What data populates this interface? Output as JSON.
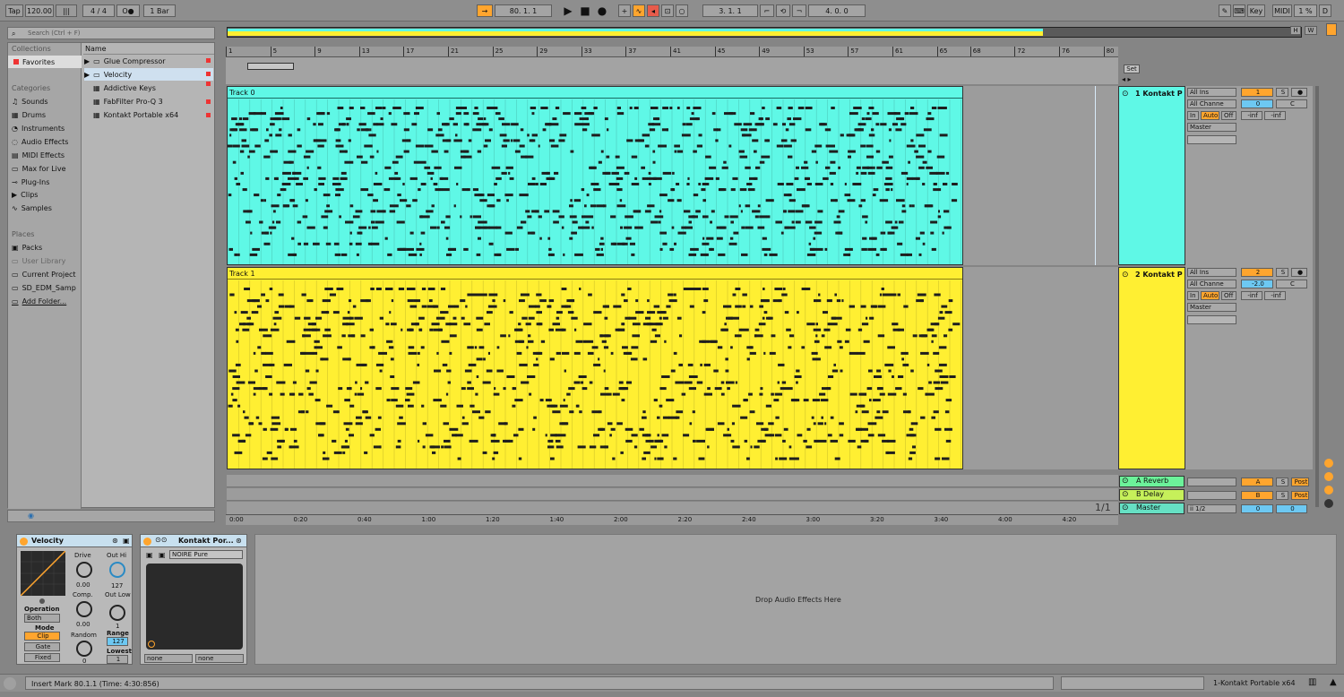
{
  "toolbar": {
    "tap": "Tap",
    "tempo": "120.00",
    "signature": "4 / 4",
    "metro": "O●",
    "quantize": "1 Bar",
    "arr_pos": "80.  1.  1",
    "loop_start": "3.  1.  1",
    "loop_len": "4.  0.  0",
    "key": "Key",
    "midi": "MIDI",
    "cpu": "1 %",
    "d": "D"
  },
  "browser": {
    "search_placeholder": "Search (Ctrl + F)",
    "collections_label": "Collections",
    "favorites": "Favorites",
    "categories_label": "Categories",
    "categories": [
      "Sounds",
      "Drums",
      "Instruments",
      "Audio Effects",
      "MIDI Effects",
      "Max for Live",
      "Plug-Ins",
      "Clips",
      "Samples"
    ],
    "places_label": "Places",
    "places": [
      "Packs",
      "User Library",
      "Current Project",
      "SD_EDM_Samp",
      "Add Folder..."
    ],
    "name_header": "Name",
    "items": [
      "Glue Compressor",
      "Velocity",
      "Addictive Keys",
      "FabFilter Pro-Q 3",
      "Kontakt Portable x64"
    ]
  },
  "ruler": {
    "bars": [
      "1",
      "5",
      "9",
      "13",
      "17",
      "21",
      "25",
      "29",
      "33",
      "37",
      "41",
      "45",
      "49",
      "53",
      "57",
      "61",
      "65",
      "68",
      "72",
      "76",
      "80"
    ],
    "times": [
      "0:00",
      "0:20",
      "0:40",
      "1:00",
      "1:20",
      "1:40",
      "2:00",
      "2:20",
      "2:40",
      "3:00",
      "3:20",
      "3:40",
      "4:00",
      "4:20"
    ],
    "zoom": "1/1",
    "set": "Set"
  },
  "tracks": [
    {
      "clip": "Track 0",
      "name": "1 Kontakt P",
      "input": "All Ins",
      "channel": "All Channe",
      "monitor": [
        "In",
        "Auto",
        "Off"
      ],
      "output": "Master",
      "number": "1",
      "solo": "S",
      "vol": "0",
      "pan": "C",
      "inf1": "-inf",
      "inf2": "-inf",
      "color": "#5ff8e6"
    },
    {
      "clip": "Track 1",
      "name": "2 Kontakt P",
      "input": "All Ins",
      "channel": "All Channe",
      "monitor": [
        "In",
        "Auto",
        "Off"
      ],
      "output": "Master",
      "number": "2",
      "solo": "S",
      "vol": "-2.0",
      "pan": "C",
      "inf1": "-inf",
      "inf2": "-inf",
      "color": "#ffef32"
    }
  ],
  "returns": [
    {
      "name": "A Reverb",
      "btn": "A",
      "solo": "S",
      "post": "Post"
    },
    {
      "name": "B Delay",
      "btn": "B",
      "solo": "S",
      "post": "Post"
    }
  ],
  "master": {
    "name": "Master",
    "cue": "ii 1/2",
    "vol": "0",
    "pan": "0"
  },
  "devices": {
    "velocity": {
      "title": "Velocity",
      "drive": "Drive",
      "drive_val": "0.00",
      "comp": "Comp.",
      "comp_val": "0.00",
      "random": "Random",
      "random_val": "0",
      "out_hi": "Out Hi",
      "out_hi_val": "127",
      "out_low": "Out Low",
      "out_low_val": "1",
      "range": "Range",
      "range_val": "127",
      "lowest": "Lowest",
      "lowest_val": "1",
      "operation": "Operation",
      "operation_val": "Both",
      "mode": "Mode",
      "modes": [
        "Clip",
        "Gate",
        "Fixed"
      ]
    },
    "kontakt": {
      "title": "Kontakt Por...",
      "preset": "NOIRE Pure",
      "sel1": "none",
      "sel2": "none"
    },
    "drop_text": "Drop Audio Effects Here"
  },
  "status": {
    "text": "Insert Mark 80.1.1 (Time: 4:30:856)",
    "track": "1-Kontakt Portable x64"
  }
}
